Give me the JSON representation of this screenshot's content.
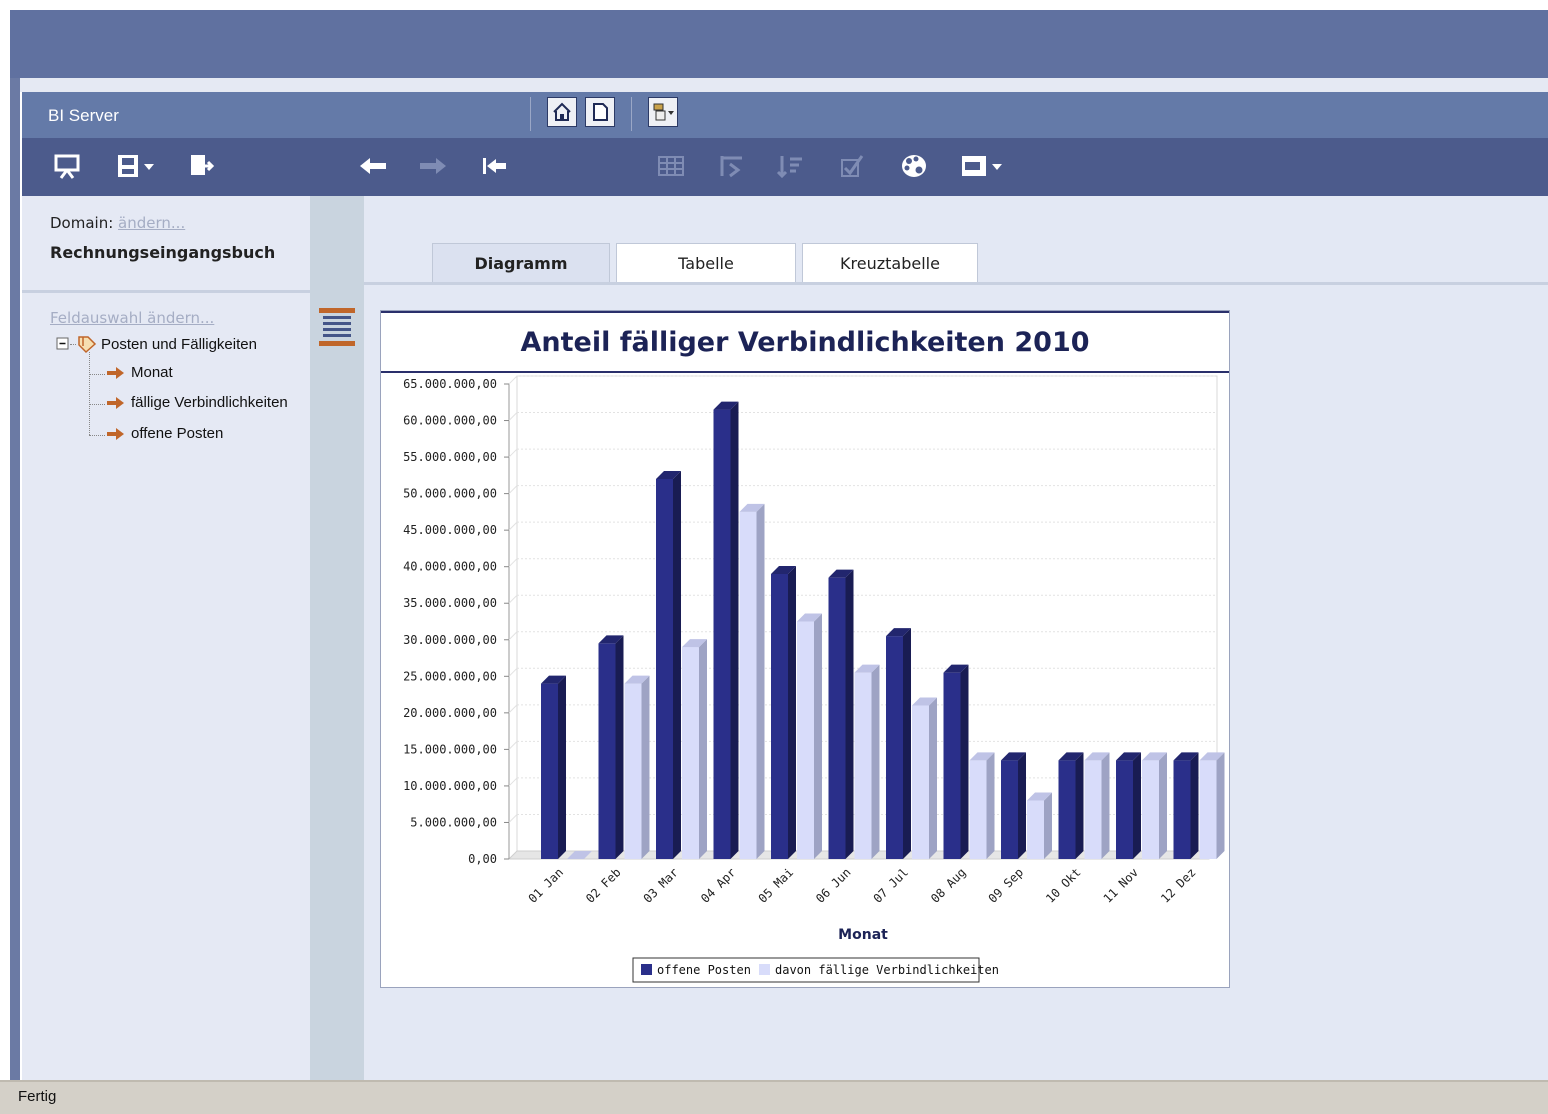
{
  "app": {
    "title": "BI Server"
  },
  "sidebar": {
    "domain_label": "Domain:",
    "domain_change_link": "ändern...",
    "domain_name": "Rechnungseingangsbuch",
    "field_selection_link": "Feldauswahl ändern...",
    "tree": {
      "root_label": "Posten und Fälligkeiten",
      "items": [
        {
          "label": "Monat"
        },
        {
          "label": "fällige Verbindlichkeiten"
        },
        {
          "label": "offene Posten"
        }
      ]
    }
  },
  "tabs": [
    {
      "label": "Diagramm",
      "active": true
    },
    {
      "label": "Tabelle",
      "active": false
    },
    {
      "label": "Kreuztabelle",
      "active": false
    }
  ],
  "chart_data": {
    "type": "bar",
    "title": "Anteil fälliger Verbindlichkeiten 2010",
    "xlabel": "Monat",
    "ylabel": "",
    "categories": [
      "01 Jan",
      "02 Feb",
      "03 Mar",
      "04 Apr",
      "05 Mai",
      "06 Jun",
      "07 Jul",
      "08 Aug",
      "09 Sep",
      "10 Okt",
      "11 Nov",
      "12 Dez"
    ],
    "series": [
      {
        "name": "offene Posten",
        "color": "#2a2f8a",
        "values": [
          24000000,
          29500000,
          52000000,
          61500000,
          39000000,
          38500000,
          30500000,
          25500000,
          13500000,
          13500000,
          13500000,
          13500000
        ]
      },
      {
        "name": "davon fällige Verbindlichkeiten",
        "color": "#d8dcfa",
        "values": [
          0,
          24000000,
          29000000,
          47500000,
          32500000,
          25500000,
          21000000,
          13500000,
          8000000,
          13500000,
          13500000,
          13500000
        ]
      }
    ],
    "ylim": [
      0,
      65000000
    ],
    "yticks": [
      "0,00",
      "5.000.000,00",
      "10.000.000,00",
      "15.000.000,00",
      "20.000.000,00",
      "25.000.000,00",
      "30.000.000,00",
      "35.000.000,00",
      "40.000.000,00",
      "45.000.000,00",
      "50.000.000,00",
      "55.000.000,00",
      "60.000.000,00",
      "65.000.000,00"
    ],
    "grid": true,
    "legend_position": "bottom"
  },
  "status": {
    "text": "Fertig"
  }
}
